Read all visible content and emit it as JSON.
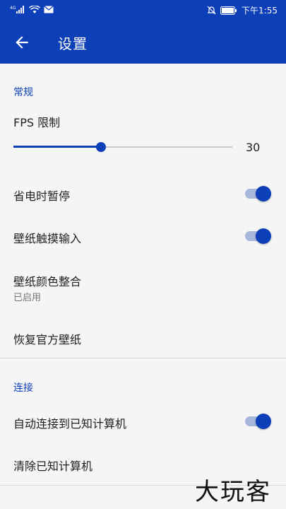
{
  "colors": {
    "primary": "#0d3fb8",
    "background": "#f5f5f5",
    "divider": "#d6d6d6"
  },
  "status_bar": {
    "time": "下午1:55",
    "icons": [
      "signal-icon",
      "wifi-icon",
      "mail-icon",
      "mute-icon",
      "battery-icon"
    ]
  },
  "toolbar": {
    "title": "设置",
    "back_icon": "back-arrow-icon"
  },
  "general": {
    "header": "常规",
    "fps": {
      "label": "FPS 限制",
      "value": "30",
      "fraction": 0.4
    },
    "pause_battery": {
      "label": "省电时暂停",
      "enabled": true
    },
    "touch_input": {
      "label": "壁纸触摸输入",
      "enabled": true
    },
    "color_integration": {
      "label": "壁纸颜色整合",
      "status": "已启用"
    },
    "restore": {
      "label": "恢复官方壁纸"
    }
  },
  "connection": {
    "header": "连接",
    "auto_connect": {
      "label": "自动连接到已知计算机",
      "enabled": true
    },
    "clear": {
      "label": "清除已知计算机"
    }
  },
  "watermark": "大玩客"
}
